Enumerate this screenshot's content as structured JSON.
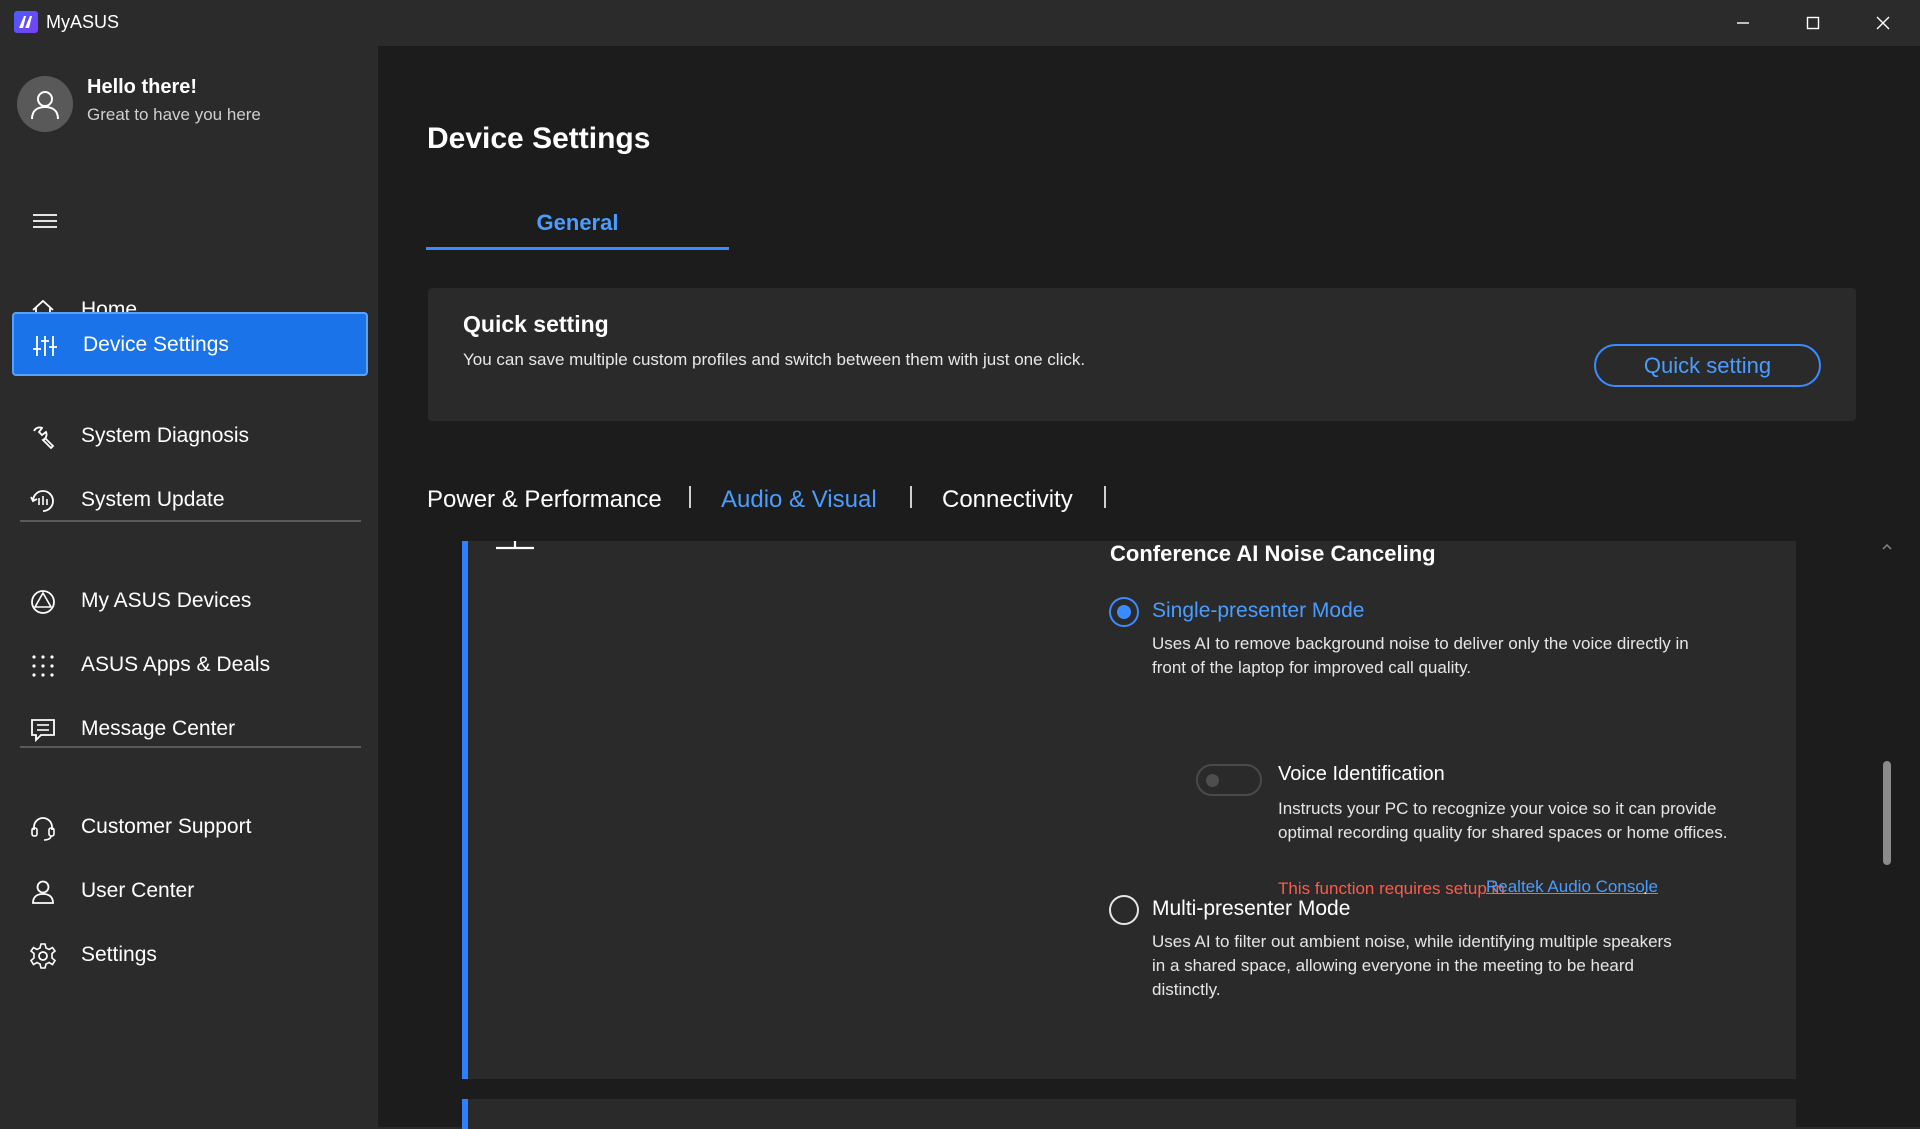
{
  "window": {
    "title": "MyASUS",
    "controls": {
      "minimize": "minimize",
      "maximize": "maximize",
      "close": "close"
    }
  },
  "user": {
    "greeting": "Hello there!",
    "subtitle": "Great to have you here"
  },
  "sidebar": {
    "items": [
      {
        "label": "Home",
        "icon": "home-icon"
      },
      {
        "label": "Device Settings",
        "icon": "sliders-icon",
        "active": true
      },
      {
        "label": "System Diagnosis",
        "icon": "wrench-icon"
      },
      {
        "label": "System Update",
        "icon": "update-icon"
      },
      {
        "label": "My ASUS Devices",
        "icon": "devices-icon"
      },
      {
        "label": "ASUS Apps & Deals",
        "icon": "apps-grid-icon"
      },
      {
        "label": "Message Center",
        "icon": "message-icon"
      },
      {
        "label": "Customer Support",
        "icon": "headset-icon"
      },
      {
        "label": "User Center",
        "icon": "user-icon"
      },
      {
        "label": "Settings",
        "icon": "gear-icon"
      }
    ]
  },
  "main": {
    "title": "Device Settings",
    "tab": "General",
    "quick_setting": {
      "title": "Quick setting",
      "description": "You can save multiple custom profiles and switch between them with just one click.",
      "button": "Quick setting"
    },
    "subtabs": [
      "Power & Performance",
      "Audio & Visual",
      "Connectivity"
    ],
    "active_subtab": "Audio & Visual",
    "noise_canceling": {
      "title": "Conference AI Noise Canceling",
      "options": [
        {
          "label": "Single-presenter Mode",
          "selected": true,
          "description": "Uses AI to remove background noise to deliver only the voice directly in front of the laptop for improved call quality."
        },
        {
          "label": "Multi-presenter Mode",
          "selected": false,
          "description": "Uses AI to filter out ambient noise, while identifying multiple speakers in a shared space, allowing everyone in the meeting to be heard distinctly."
        }
      ],
      "voice_id": {
        "label": "Voice Identification",
        "enabled": false,
        "description": "Instructs your PC to recognize your voice so it can provide optimal recording quality for shared spaces or home offices.",
        "warning": "This function requires setup in",
        "link": "Realtek Audio Console",
        "period": "."
      }
    }
  },
  "colors": {
    "accent": "#1a73e8",
    "link": "#4a9dff",
    "warning": "#ff5a4a",
    "background": "#1c1c1c",
    "sidebar": "#2b2b2b"
  }
}
